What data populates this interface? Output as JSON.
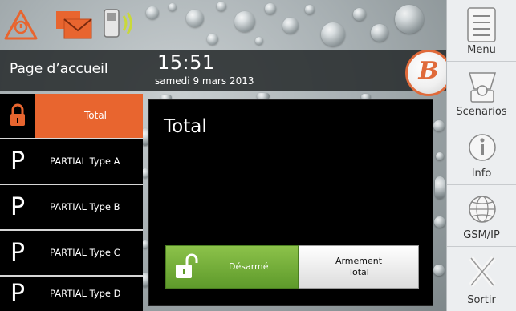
{
  "header": {
    "page_title": "Page d’accueil",
    "time": "15:51",
    "date": "samedi 9 mars 2013",
    "status_icons": [
      "alert-icon",
      "mail-icon",
      "gsm-signal-icon"
    ],
    "logo": "B"
  },
  "left_list": [
    {
      "badge_icon": "padlock-icon",
      "label": "Total",
      "active": true
    },
    {
      "badge": "P",
      "label": "PARTIAL  Type A"
    },
    {
      "badge": "P",
      "label": "PARTIAL  Type B"
    },
    {
      "badge": "P",
      "label": "PARTIAL  Type C"
    },
    {
      "badge": "P",
      "label": "PARTIAL  Type D"
    }
  ],
  "modal": {
    "title": "Total",
    "disarm_label": "Désarmé",
    "arm_label_line1": "Armement",
    "arm_label_line2": "Total"
  },
  "sidebar": [
    {
      "label": "Menu",
      "icon": "menu-icon"
    },
    {
      "label": "Scenarios",
      "icon": "scenarios-icon"
    },
    {
      "label": "Info",
      "icon": "info-icon"
    },
    {
      "label": "GSM/IP",
      "icon": "globe-icon"
    },
    {
      "label": "Sortir",
      "icon": "exit-icon"
    }
  ],
  "colors": {
    "accent": "#e8652f",
    "disarm_green": "#6fae34",
    "modal_bg": "#000000"
  }
}
